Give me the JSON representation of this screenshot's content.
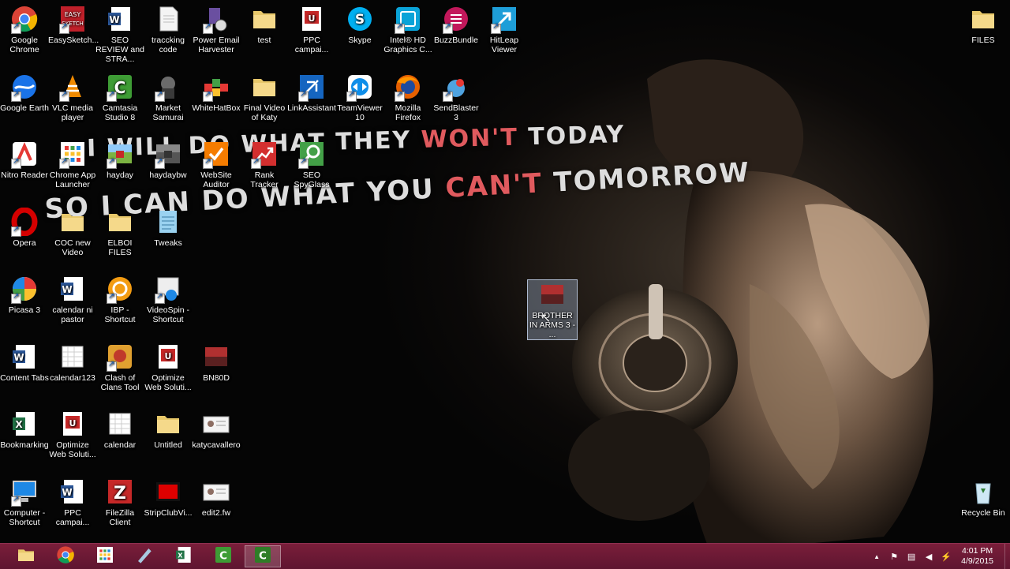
{
  "wallpaper": {
    "line1": {
      "a": "I WILL DO WHAT THEY ",
      "red": "WON'T",
      "b": " TODAY"
    },
    "line2": {
      "a": "SO I CAN DO WHAT YOU ",
      "red": "CAN'T",
      "b": " TOMORROW"
    }
  },
  "icons": [
    {
      "label": "Google Chrome",
      "icon": "chrome-icon"
    },
    {
      "label": "EasySketch...",
      "icon": "easysketch-icon"
    },
    {
      "label": "SEO REVIEW and STRA...",
      "icon": "word-doc-icon"
    },
    {
      "label": "traccking code",
      "icon": "text-file-icon"
    },
    {
      "label": "Power Email Harvester",
      "icon": "email-harvester-icon"
    },
    {
      "label": "test",
      "icon": "folder-icon"
    },
    {
      "label": "PPC campai...",
      "icon": "pdf-icon"
    },
    {
      "label": "Skype",
      "icon": "skype-icon"
    },
    {
      "label": "Intel® HD Graphics C...",
      "icon": "intel-graphics-icon"
    },
    {
      "label": "BuzzBundle",
      "icon": "buzzbundle-icon"
    },
    {
      "label": "HitLeap Viewer",
      "icon": "hitleap-icon"
    },
    {
      "label": "Google Earth",
      "icon": "google-earth-icon"
    },
    {
      "label": "VLC media player",
      "icon": "vlc-icon"
    },
    {
      "label": "Camtasia Studio 8",
      "icon": "camtasia-icon"
    },
    {
      "label": "Market Samurai",
      "icon": "market-samurai-icon"
    },
    {
      "label": "WhiteHatBox",
      "icon": "whitehatbox-icon"
    },
    {
      "label": "Final Video of Katy",
      "icon": "folder-icon"
    },
    {
      "label": "LinkAssistant",
      "icon": "linkassistant-icon"
    },
    {
      "label": "TeamViewer 10",
      "icon": "teamviewer-icon"
    },
    {
      "label": "Mozilla Firefox",
      "icon": "firefox-icon"
    },
    {
      "label": "SendBlaster 3",
      "icon": "sendblaster-icon"
    },
    {
      "label": "Nitro Reader",
      "icon": "nitro-icon"
    },
    {
      "label": "Chrome App Launcher",
      "icon": "app-launcher-icon"
    },
    {
      "label": "hayday",
      "icon": "hayday-icon"
    },
    {
      "label": "haydaybw",
      "icon": "haydaybw-icon"
    },
    {
      "label": "WebSite Auditor",
      "icon": "website-auditor-icon"
    },
    {
      "label": "Rank Tracker",
      "icon": "rank-tracker-icon"
    },
    {
      "label": "SEO SpyGlass",
      "icon": "seo-spyglass-icon"
    },
    {
      "label": "Opera",
      "icon": "opera-icon"
    },
    {
      "label": "COC new Video",
      "icon": "folder-icon"
    },
    {
      "label": "ELBOI FILES",
      "icon": "folder-icon"
    },
    {
      "label": "Tweaks",
      "icon": "notepad-icon"
    },
    {
      "label": "BROTHER IN ARMS 3 - ...",
      "icon": "image-file-icon"
    },
    {
      "label": "Picasa 3",
      "icon": "picasa-icon"
    },
    {
      "label": "calendar ni pastor",
      "icon": "word-doc-icon"
    },
    {
      "label": "IBP - Shortcut",
      "icon": "ibp-icon"
    },
    {
      "label": "VideoSpin - Shortcut",
      "icon": "videospin-icon"
    },
    {
      "label": "Content Tabs",
      "icon": "word-doc-icon"
    },
    {
      "label": "calendar123",
      "icon": "calendar-file-icon"
    },
    {
      "label": "Clash of Clans Tool",
      "icon": "clash-of-clans-icon"
    },
    {
      "label": "Optimize Web Soluti...",
      "icon": "pdf-icon"
    },
    {
      "label": "BN80D",
      "icon": "image-file-icon"
    },
    {
      "label": "Bookmarking",
      "icon": "excel-icon"
    },
    {
      "label": "Optimize Web Soluti...",
      "icon": "pdf-icon"
    },
    {
      "label": "calendar",
      "icon": "calendar-file-icon"
    },
    {
      "label": "Untitled",
      "icon": "folder-icon"
    },
    {
      "label": "katycavallero",
      "icon": "id-card-icon"
    },
    {
      "label": "Computer - Shortcut",
      "icon": "computer-icon"
    },
    {
      "label": "PPC campai...",
      "icon": "word-doc-icon"
    },
    {
      "label": "FileZilla Client",
      "icon": "filezilla-icon"
    },
    {
      "label": "StripClubVi...",
      "icon": "video-file-icon"
    },
    {
      "label": "edit2.fw",
      "icon": "id-card-icon"
    },
    {
      "label": "FILES",
      "icon": "folder-icon"
    },
    {
      "label": "Recycle Bin",
      "icon": "recycle-bin-icon"
    }
  ],
  "taskbar": {
    "apps": [
      {
        "icon": "file-explorer-icon"
      },
      {
        "icon": "chrome-icon"
      },
      {
        "icon": "app-launcher-icon"
      },
      {
        "icon": "pen-tool-icon"
      },
      {
        "icon": "excel-icon"
      },
      {
        "icon": "camtasia-icon"
      },
      {
        "icon": "camtasia-recorder-icon"
      }
    ],
    "tray_icons": [
      "up-arrow-icon",
      "flag-icon",
      "network-icon",
      "volume-icon",
      "power-icon"
    ],
    "clock": {
      "time": "4:01 PM",
      "date": "4/9/2015"
    }
  },
  "colors": {
    "taskbar": "#6a1a35",
    "wallpaper_accent": "#e05a5e"
  }
}
